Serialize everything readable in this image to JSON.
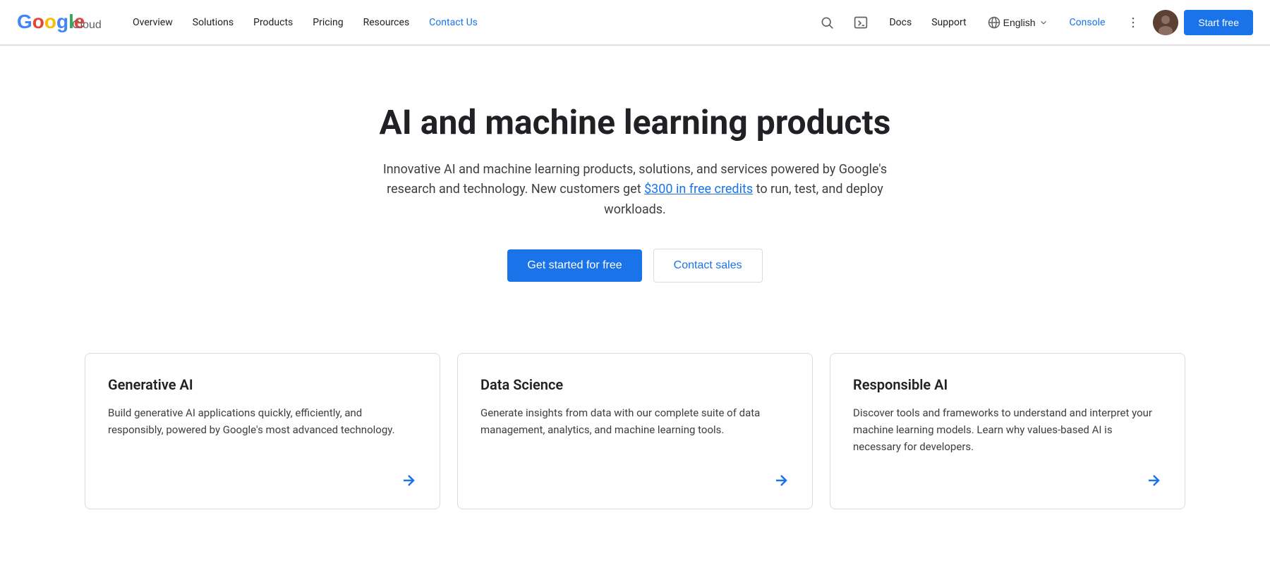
{
  "nav": {
    "logo_text": "Google Cloud",
    "links": [
      {
        "label": "Overview",
        "active": false
      },
      {
        "label": "Solutions",
        "active": false
      },
      {
        "label": "Products",
        "active": false
      },
      {
        "label": "Pricing",
        "active": false
      },
      {
        "label": "Resources",
        "active": false
      },
      {
        "label": "Contact Us",
        "active": true
      }
    ],
    "docs_label": "Docs",
    "support_label": "Support",
    "lang_label": "English",
    "console_label": "Console",
    "start_free_label": "Start free"
  },
  "hero": {
    "title": "AI and machine learning products",
    "subtitle_pre": "Innovative AI and machine learning products, solutions, and services powered by Google's research and technology. New customers get ",
    "subtitle_link": "$300 in free credits",
    "subtitle_post": " to run, test, and deploy workloads.",
    "cta_primary": "Get started for free",
    "cta_secondary": "Contact sales"
  },
  "cards": [
    {
      "title": "Generative AI",
      "desc": "Build generative AI applications quickly, efficiently, and responsibly, powered by Google's most advanced technology."
    },
    {
      "title": "Data Science",
      "desc": "Generate insights from data with our complete suite of data management, analytics, and machine learning tools."
    },
    {
      "title": "Responsible AI",
      "desc": "Discover tools and frameworks to understand and interpret your machine learning models. Learn why values-based AI is necessary for developers."
    }
  ]
}
